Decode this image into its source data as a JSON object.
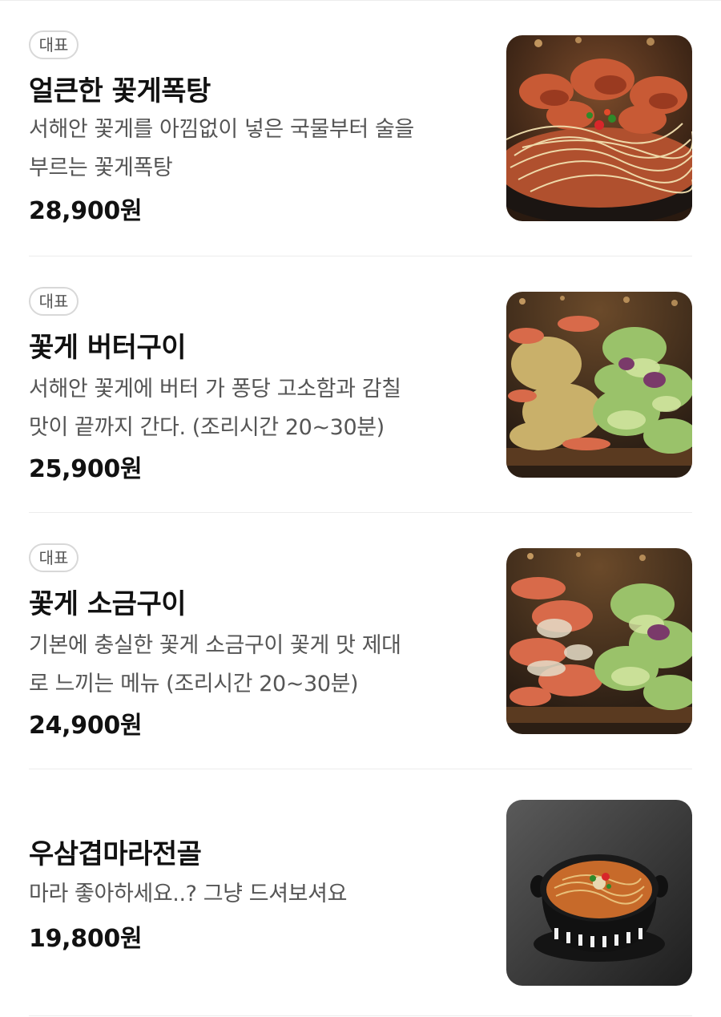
{
  "menu": {
    "items": [
      {
        "badge": "대표",
        "name": "얼큰한 꽃게폭탕",
        "desc_line1": "서해안 꽃게를 아낌없이 넣은 국물부터 술을",
        "desc_line2": "부르는 꽃게폭탕",
        "price": "28,900원",
        "image_icon": "spicy-crab-stew-photo"
      },
      {
        "badge": "대표",
        "name": "꽃게 버터구이",
        "desc_line1": "서해안 꽃게에 버터 가 퐁당 고소함과 감칠",
        "desc_line2": "맛이 끝까지 간다. (조리시간 20~30분)",
        "price": "25,900원",
        "image_icon": "butter-grilled-crab-photo"
      },
      {
        "badge": "대표",
        "name": "꽃게 소금구이",
        "desc_line1": "기본에 충실한 꽃게 소금구이 꽃게 맛 제대",
        "desc_line2": "로 느끼는 메뉴 (조리시간 20~30분)",
        "price": "24,900원",
        "image_icon": "salt-grilled-crab-photo"
      },
      {
        "name": "우삼겹마라전골",
        "desc_line1": "마라 좋아하세요..? 그냥 드셔보셔요",
        "price": "19,800원",
        "image_icon": "mala-hotpot-photo"
      }
    ]
  },
  "colors": {
    "divider": "#ececec",
    "badge_border": "#d8d8d8",
    "desc_text": "#555555",
    "title_text": "#111111"
  }
}
